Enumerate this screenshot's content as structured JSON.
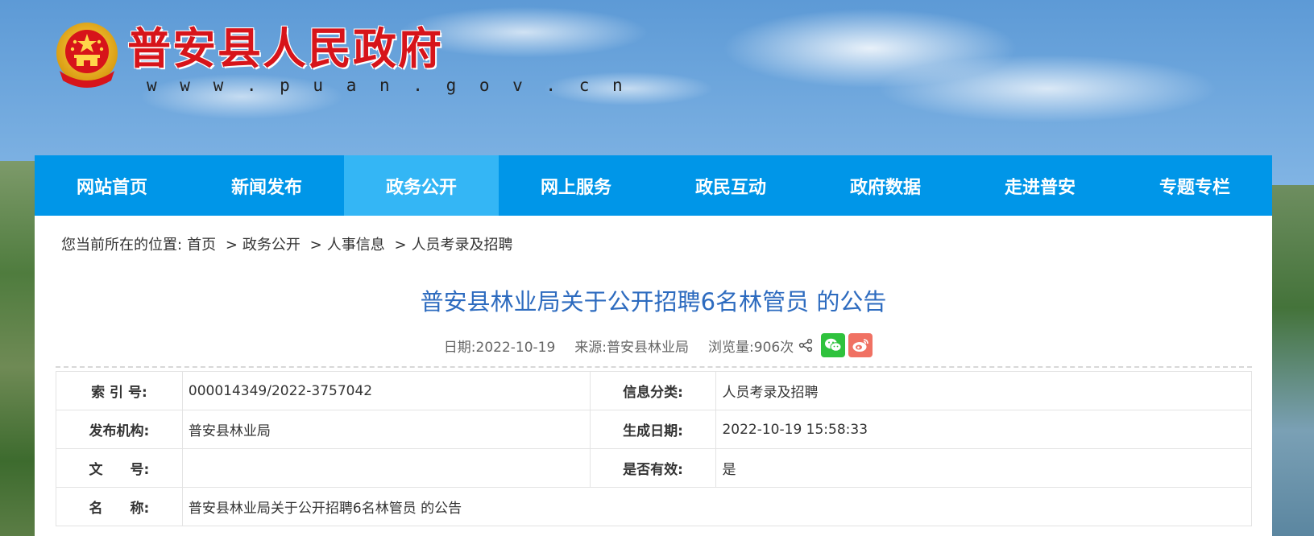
{
  "header": {
    "site_title": "普安县人民政府",
    "site_url": "w w w . p u a n . g o v . c n",
    "emblem_icon": "national-emblem-icon",
    "brand_color": "#d7141a"
  },
  "nav": {
    "accent_color": "#0096e8",
    "active_color": "#34b6f5",
    "items": [
      {
        "label": "网站首页"
      },
      {
        "label": "新闻发布"
      },
      {
        "label": "政务公开"
      },
      {
        "label": "网上服务"
      },
      {
        "label": "政民互动"
      },
      {
        "label": "政府数据"
      },
      {
        "label": "走进普安"
      },
      {
        "label": "专题专栏"
      }
    ],
    "active_index": 2
  },
  "breadcrumb": {
    "prefix": "您当前所在的位置:",
    "items": [
      "首页",
      "政务公开",
      "人事信息",
      "人员考录及招聘"
    ],
    "separator": ">"
  },
  "article": {
    "title": "普安县林业局关于公开招聘6名林管员 的公告",
    "date_label": "日期:",
    "date": "2022-10-19",
    "source_label": "来源:",
    "source": "普安县林业局",
    "views_label": "浏览量:",
    "views": "906次",
    "share_icon": "share-icon",
    "wechat_icon": "wechat-icon",
    "weibo_icon": "weibo-icon"
  },
  "info_table": {
    "index_label": "索 引 号:",
    "index_value": "000014349/2022-3757042",
    "category_label": "信息分类:",
    "category_value": "人员考录及招聘",
    "org_label": "发布机构:",
    "org_value": "普安县林业局",
    "created_label": "生成日期:",
    "created_value": "2022-10-19 15:58:33",
    "docno_label": "文　　号:",
    "docno_value": "",
    "valid_label": "是否有效:",
    "valid_value": "是",
    "name_label": "名　　称:",
    "name_value": "普安县林业局关于公开招聘6名林管员 的公告"
  }
}
